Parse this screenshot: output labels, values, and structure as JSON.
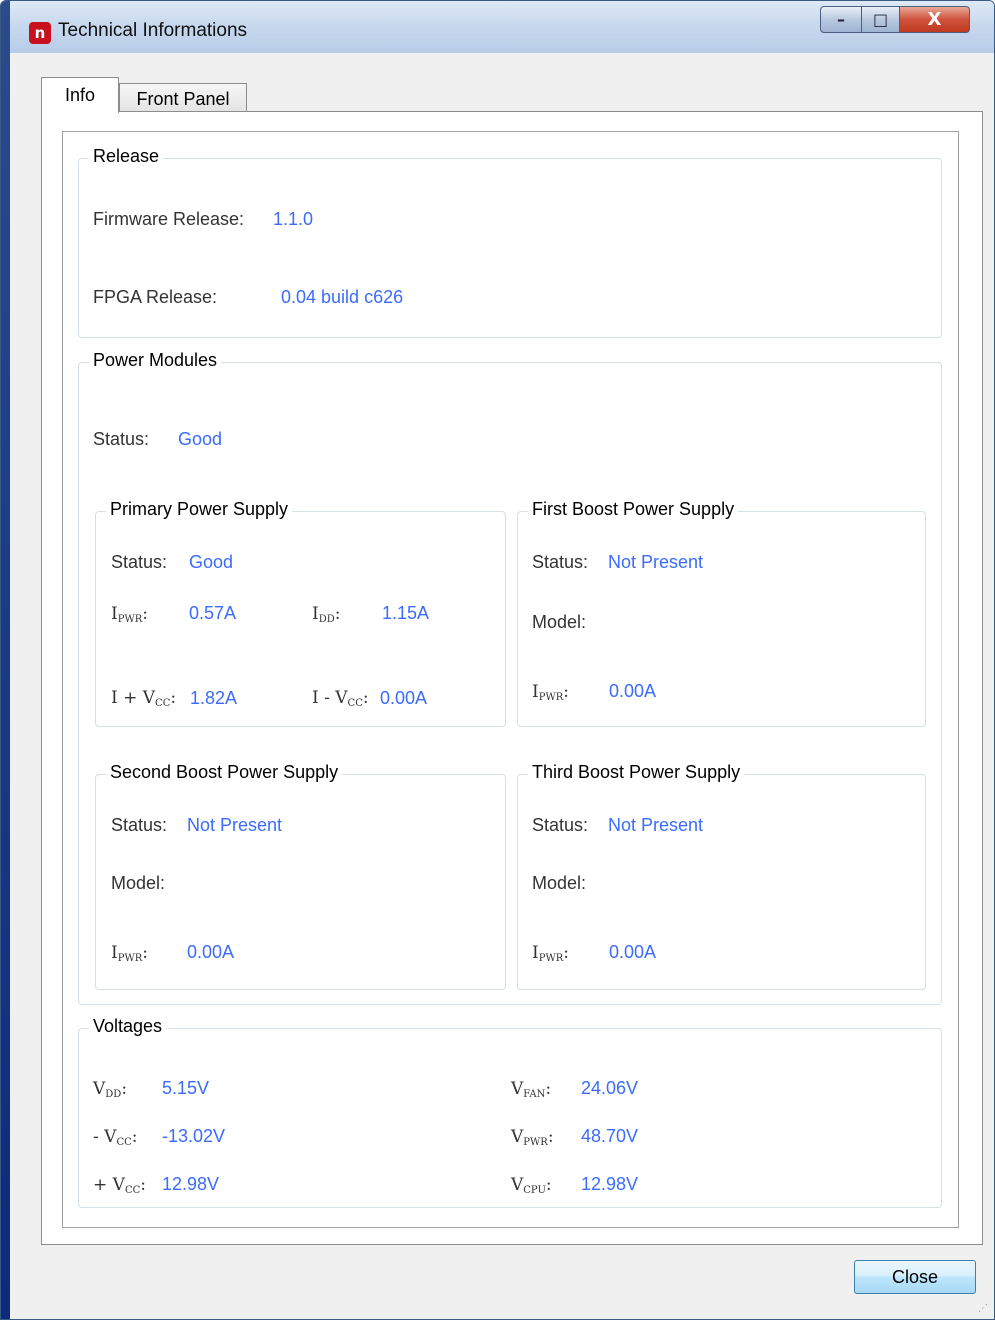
{
  "window": {
    "title": "Technical Informations",
    "app_icon_glyph": "n",
    "buttons": {
      "minimize": "–",
      "maximize": "□",
      "close": "X"
    }
  },
  "tabs": [
    {
      "label": "Info",
      "active": true
    },
    {
      "label": "Front Panel",
      "active": false
    }
  ],
  "release": {
    "title": "Release",
    "firmware_label": "Firmware Release:",
    "firmware_value": "1.1.0",
    "fpga_label": "FPGA Release:",
    "fpga_value": "0.04 build c626"
  },
  "power_modules": {
    "title": "Power Modules",
    "status_label": "Status:",
    "status_value": "Good",
    "primary": {
      "title": "Primary Power Supply",
      "status_label": "Status:",
      "status_value": "Good",
      "ipwr_value": "0.57A",
      "idd_value": "1.15A",
      "i_plus_vcc_value": "1.82A",
      "i_minus_vcc_value": "0.00A"
    },
    "first_boost": {
      "title": "First Boost Power Supply",
      "status_label": "Status:",
      "status_value": "Not Present",
      "model_label": "Model:",
      "ipwr_value": "0.00A"
    },
    "second_boost": {
      "title": "Second Boost Power Supply",
      "status_label": "Status:",
      "status_value": "Not Present",
      "model_label": "Model:",
      "ipwr_value": "0.00A"
    },
    "third_boost": {
      "title": "Third Boost Power Supply",
      "status_label": "Status:",
      "status_value": "Not Present",
      "model_label": "Model:",
      "ipwr_value": "0.00A"
    }
  },
  "voltages": {
    "title": "Voltages",
    "vdd_value": "5.15V",
    "minus_vcc_value": "-13.02V",
    "plus_vcc_value": "12.98V",
    "vfan_value": "24.06V",
    "vpwr_value": "48.70V",
    "vcpu_value": "12.98V"
  },
  "labels": {
    "i": "I",
    "v": "V",
    "pwr": "PWR",
    "dd": "DD",
    "cc": "CC",
    "fan": "FAN",
    "cpu": "CPU",
    "i_plus_v": "I + V",
    "i_minus_v": "I - V",
    "minus_v": "- V",
    "plus_v": "+ V",
    "colon": ":"
  },
  "footer": {
    "close_label": "Close"
  },
  "colors": {
    "value_blue": "#3b6bff",
    "app_icon_red": "#c8101e"
  },
  "icons": {
    "app": "app-logo-icon",
    "minimize": "minimize-icon",
    "maximize": "maximize-icon",
    "close": "close-icon",
    "grip": "resize-grip-icon"
  }
}
